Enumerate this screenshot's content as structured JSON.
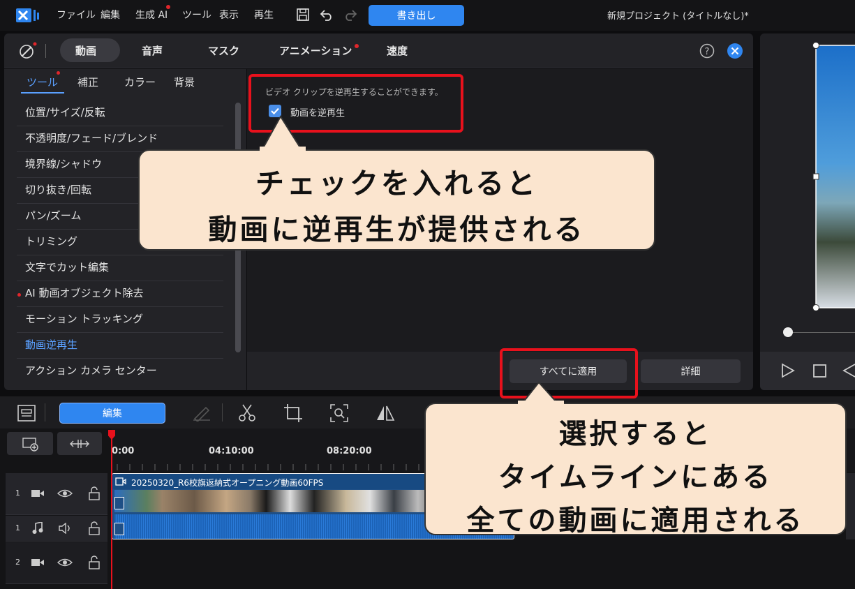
{
  "menubar": {
    "items": [
      "ファイル",
      "編集",
      "生成 AI",
      "ツール",
      "表示",
      "再生"
    ],
    "export_label": "書き出し",
    "project_title": "新規プロジェクト (タイトルなし)*"
  },
  "tabs": [
    "動画",
    "音声",
    "マスク",
    "アニメーション",
    "速度"
  ],
  "subtabs": [
    "ツール",
    "補正",
    "カラー",
    "背景"
  ],
  "tools": [
    "位置/サイズ/反転",
    "不透明度/フェード/ブレンド",
    "境界線/シャドウ",
    "切り抜き/回転",
    "パン/ズーム",
    "トリミング",
    "文字でカット編集",
    "AI 動画オブジェクト除去",
    "モーション トラッキング",
    "動画逆再生",
    "アクション カメラ センター"
  ],
  "content": {
    "description": "ビデオ クリップを逆再生することができます。",
    "checkbox_label": "動画を逆再生"
  },
  "buttons": {
    "apply_all": "すべてに適用",
    "details": "詳細"
  },
  "callouts": {
    "top_line1": "チェックを入れると",
    "top_line2": "動画に逆再生が提供される",
    "bottom_line1": "選択すると",
    "bottom_line2": "タイムラインにある",
    "bottom_line3": "全ての動画に適用される"
  },
  "timeline": {
    "edit_label": "編集",
    "ruler": [
      "0:00",
      "04:10:00",
      "08:20:00"
    ],
    "clip_title": "20250320_R6校旗返納式オープニング動画60FPS",
    "tracks": [
      "1",
      "1",
      "2"
    ]
  },
  "colors": {
    "accent": "#2f86f0",
    "highlight": "#e8111c",
    "callout_bg": "#fbe5cf",
    "selected_tool": "#5aa0ff"
  }
}
